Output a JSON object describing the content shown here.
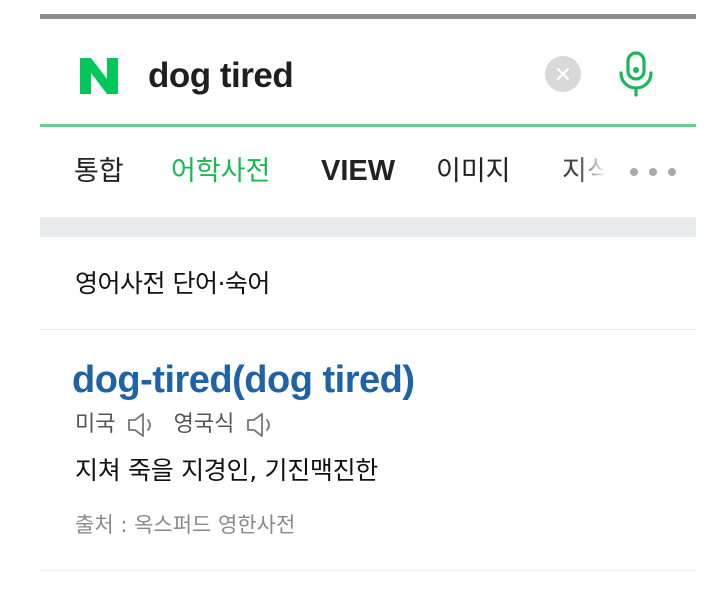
{
  "search": {
    "query": "dog tired",
    "logo_letter": "N",
    "clear_icon": "clear-icon",
    "mic_icon": "microphone-icon"
  },
  "tabs": [
    {
      "label": "통합",
      "active": false
    },
    {
      "label": "어학사전",
      "active": true
    },
    {
      "label": "VIEW",
      "active": false
    },
    {
      "label": "이미지",
      "active": false
    },
    {
      "label": "지식",
      "active": false
    }
  ],
  "more_icon": "more-dots-icon",
  "section": {
    "title": "영어사전 단어·숙어"
  },
  "entry": {
    "headword": "dog-tired(dog tired)",
    "pron_us_label": "미국",
    "pron_uk_label": "영국식",
    "speaker_icon": "speaker-icon",
    "meaning": "지쳐 죽을 지경인, 기진맥진한",
    "source": "출처 : 옥스퍼드 영한사전"
  },
  "colors": {
    "brand_green": "#03c75a",
    "active_tab": "#19ba53",
    "headword_blue": "#1f63a7",
    "divider_green": "#6ccf8f"
  }
}
